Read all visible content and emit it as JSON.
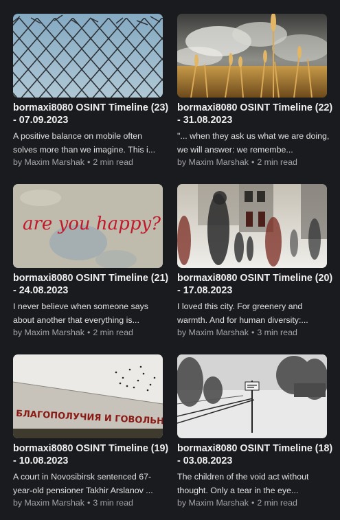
{
  "articles": [
    {
      "title": "bormaxi8080 OSINT Timeline (23) - 07.09.2023",
      "excerpt": "A positive balance on mobile often solves more than we imagine. This i...",
      "author": "by Maxim Marshak",
      "separator": "•",
      "read_time": "2 min read",
      "image": "chain-link-fence-sky"
    },
    {
      "title": "bormaxi8080 OSINT Timeline (22) - 31.08.2023",
      "excerpt": "\"... when they ask us what we are doing, we will answer: we remembe...",
      "author": "by Maxim Marshak",
      "separator": "•",
      "read_time": "2 min read",
      "image": "wheat-field-storm-clouds"
    },
    {
      "title": "bormaxi8080 OSINT Timeline (21) - 24.08.2023",
      "excerpt": "I never believe when someone says about another that everything is...",
      "author": "by Maxim Marshak",
      "separator": "•",
      "read_time": "2 min read",
      "image": "graffiti-wall",
      "image_text": "are you happy?"
    },
    {
      "title": "bormaxi8080 OSINT Timeline (20) - 17.08.2023",
      "excerpt": "I loved this city. For greenery and warmth. And for human diversity:...",
      "author": "by Maxim Marshak",
      "separator": "•",
      "read_time": "3 min read",
      "image": "blurred-street-people"
    },
    {
      "title": "bormaxi8080 OSINT Timeline (19) - 10.08.2023",
      "excerpt": "A court in Novosibirsk sentenced 67-year-old pensioner Takhir Arslanov ...",
      "author": "by Maxim Marshak",
      "separator": "•",
      "read_time": "3 min read",
      "image": "wall-inscription-birds",
      "image_text": "БЛАГОПОЛУЧИЯ И ГОВОЛЬНОСТИ"
    },
    {
      "title": "bormaxi8080 OSINT Timeline (18) - 03.08.2023",
      "excerpt": "The children of the void act without thought. Only a tear in the eye...",
      "author": "by Maxim Marshak",
      "separator": "•",
      "read_time": "2 min read",
      "image": "snowy-railway"
    }
  ]
}
